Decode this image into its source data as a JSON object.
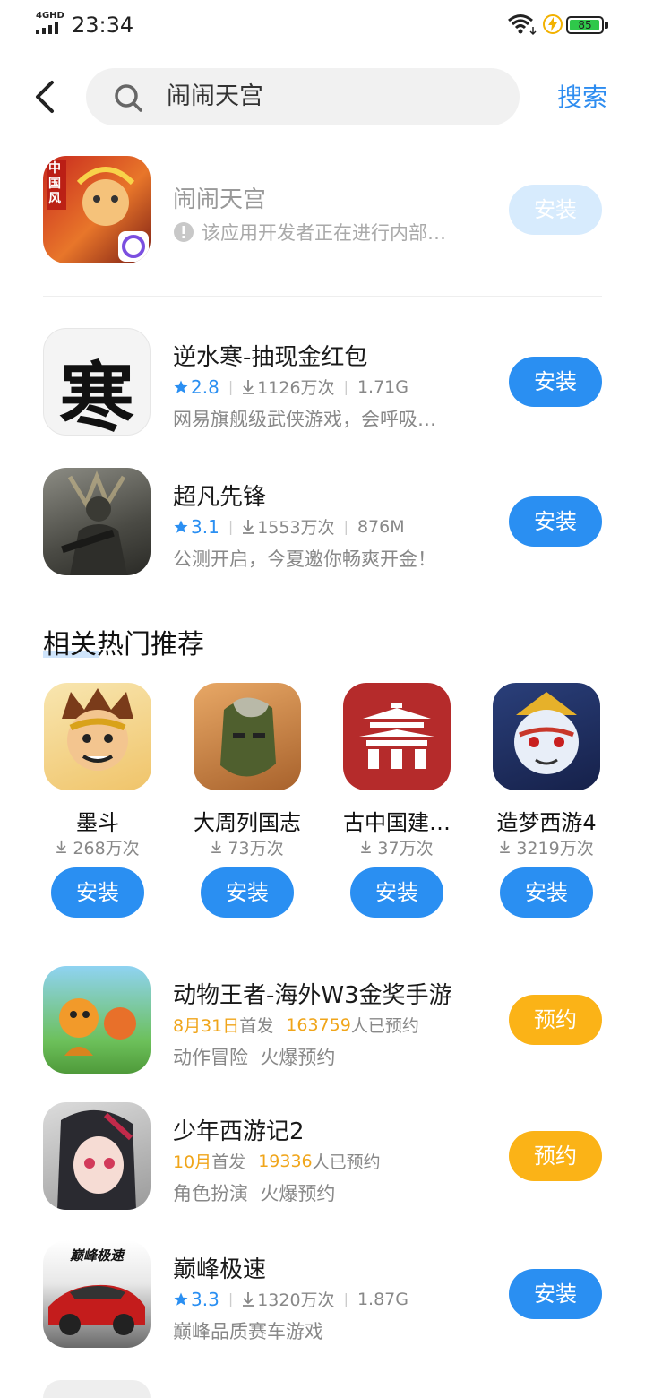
{
  "status_bar": {
    "signal_label": "4GHD",
    "time": "23:34",
    "battery": "85"
  },
  "search": {
    "query": "闹闹天宫",
    "button_label": "搜索"
  },
  "top_result": {
    "title": "闹闹天宫",
    "warning": "该应用开发者正在进行内部…",
    "button": "安装",
    "icon_badge": "中国风"
  },
  "results": [
    {
      "title": "逆水寒-抽现金红包",
      "rating": "2.8",
      "downloads": "1126万次",
      "size": "1.71G",
      "desc": "网易旗舰级武侠游戏，会呼吸…",
      "button": "安装",
      "icon_glyph": "寒"
    },
    {
      "title": "超凡先锋",
      "rating": "3.1",
      "downloads": "1553万次",
      "size": "876M",
      "desc": "公测开启，今夏邀你畅爽开金！",
      "button": "安装"
    }
  ],
  "section": {
    "title": "相关热门推荐"
  },
  "recommendations": [
    {
      "name": "墨斗",
      "count": "268万次",
      "button": "安装"
    },
    {
      "name": "大周列国志",
      "count": "73万次",
      "button": "安装"
    },
    {
      "name": "古中国建…",
      "count": "37万次",
      "button": "安装"
    },
    {
      "name": "造梦西游4",
      "count": "3219万次",
      "button": "安装"
    }
  ],
  "more_results": [
    {
      "title": "动物王者-海外W3金奖手游",
      "date": "8月31日",
      "date_suffix": "首发",
      "reservations": "163759",
      "res_suffix": "人已预约",
      "desc": "动作冒险  火爆预约",
      "button": "预约"
    },
    {
      "title": "少年西游记2",
      "date": "10月",
      "date_suffix": "首发",
      "reservations": "19336",
      "res_suffix": "人已预约",
      "desc": "角色扮演  火爆预约",
      "button": "预约"
    },
    {
      "title": "巅峰极速",
      "rating": "3.3",
      "downloads": "1320万次",
      "size": "1.87G",
      "desc": "巅峰品质赛车游戏",
      "button": "安装",
      "icon_text": "巅峰极速"
    }
  ],
  "colors": {
    "accent": "#2a8ff2",
    "orange": "#fbb317",
    "disabled": "#d7ebfd"
  }
}
